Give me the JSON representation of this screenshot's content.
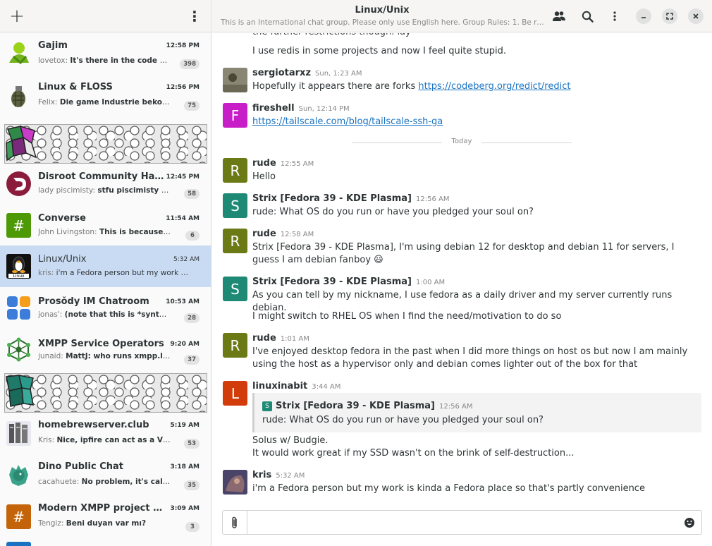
{
  "sidebar": {
    "add_label": "+",
    "menu_label": "⋮",
    "conversations": [
      {
        "name": "Gajim",
        "time": "12:58 PM",
        "sender": "lovetox:",
        "message": "It's there in the code searc...",
        "badge": "398"
      },
      {
        "name": "Linux & FLOSS",
        "time": "12:56 PM",
        "sender": "Felix:",
        "message": "Die game Industrie bekommt e...",
        "badge": "75"
      },
      {
        "name": "Disroot Community Hangout",
        "time": "12:45 PM",
        "sender": "lady piscimisty:",
        "message": "stfu piscimisty ur hi...",
        "badge": "58"
      },
      {
        "name": "Converse",
        "time": "11:54 AM",
        "sender": "John Livingston:",
        "message": "This is because Peert...",
        "badge": "6"
      },
      {
        "name": "Linux/Unix",
        "time": "5:32 AM",
        "sender": "kris:",
        "message": "i'm a Fedora person but my work is ki..."
      },
      {
        "name": "Prosŏdy IM Chatroom",
        "time": "10:53 AM",
        "sender": "jonas':",
        "message": "(note that this is *syntax* err...",
        "badge": "28"
      },
      {
        "name": "XMPP Service Operators",
        "time": "9:20 AM",
        "sender": "junaid:",
        "message": "MattJ: who runs xmpp.link?",
        "badge": "37"
      },
      {
        "name": "homebrewserver.club",
        "time": "5:19 AM",
        "sender": "Kris:",
        "message": "Nice, ipfire can act as a VM host...",
        "badge": "53"
      },
      {
        "name": "Dino Public Chat",
        "time": "3:18 AM",
        "sender": "cacahuete:",
        "message": "No problem, it's called FA...",
        "badge": "35"
      },
      {
        "name": "Modern XMPP project discu...",
        "time": "3:09 AM",
        "sender": "Tengiz:",
        "message": "Beni duyan var mı?",
        "badge": "3"
      }
    ]
  },
  "header": {
    "title": "Linux/Unix",
    "subtitle": "This is an International chat group. Please only use English here. Group Rules: 1. Be respectful..."
  },
  "messages": {
    "partial_top": "the further restrictions though. lay",
    "m1": {
      "text": "I use redis in some projects and now I feel quite stupid."
    },
    "m2": {
      "nick": "sergiotarxz",
      "time": "Sun,   1:23 AM",
      "text": "Hopefully it appears there are forks ",
      "link": "https://codeberg.org/redict/redict"
    },
    "m3": {
      "avatar": "F",
      "nick": "fireshell",
      "time": "Sun, 12:14 PM",
      "link": "https://tailscale.com/blog/tailscale-ssh-ga"
    },
    "day_separator": "Today",
    "m4": {
      "avatar": "R",
      "nick": "rude",
      "time": "12:55 AM",
      "text": "Hello"
    },
    "m5": {
      "avatar": "S",
      "nick": "Strix [Fedora 39 - KDE Plasma]",
      "time": "12:56 AM",
      "text": "rude: What OS do you run or have you pledged your soul on?"
    },
    "m6": {
      "avatar": "R",
      "nick": "rude",
      "time": "12:58 AM",
      "text": "Strix [Fedora 39 - KDE Plasma], I'm using debian 12 for desktop and debian 11 for servers, I guess I am debian fanboy 😃"
    },
    "m7": {
      "avatar": "S",
      "nick": "Strix [Fedora 39 - KDE Plasma]",
      "time": "1:00 AM",
      "text": "As you can tell by my nickname, I use fedora as a daily driver and my server currently runs debian."
    },
    "m8": {
      "text": "I might switch to RHEL OS when I find the need/motivation to do so"
    },
    "m9": {
      "avatar": "R",
      "nick": "rude",
      "time": "1:01 AM",
      "text": "I've enjoyed desktop fedora in the past when I did more things on host os but now I am mainly using the host as a hypervisor only and debian comes lighter out of the box for that"
    },
    "m10": {
      "avatar": "L",
      "nick": "linuxinabit",
      "time": "3:44 AM",
      "quote": {
        "avatar": "S",
        "nick": "Strix [Fedora 39 - KDE Plasma]",
        "time": "12:56 AM",
        "text": "rude: What OS do you run or have you pledged your soul on?"
      },
      "line1": "Solus w/ Budgie.",
      "line2": "It would work great if my SSD wasn't on the brink of self-destruction..."
    },
    "m11": {
      "nick": "kris",
      "time": "5:32 AM",
      "text": "i'm  a Fedora person but my work is kinda a Fedora place so that's partly convenience"
    }
  },
  "composer": {
    "placeholder": ""
  },
  "colors": {
    "selected_row": "#c9dbf3",
    "avatar_rude": "#6b7a15",
    "avatar_strix": "#1e8a76",
    "avatar_fireshell": "#c81ec8",
    "avatar_linuxinabit": "#d23c0a",
    "link": "#1a73c2"
  },
  "icons": [
    "plus-icon",
    "kebab-menu-icon",
    "people-icon",
    "search-icon",
    "minimize-icon",
    "maximize-icon",
    "close-icon",
    "paperclip-icon",
    "emoji-icon"
  ]
}
